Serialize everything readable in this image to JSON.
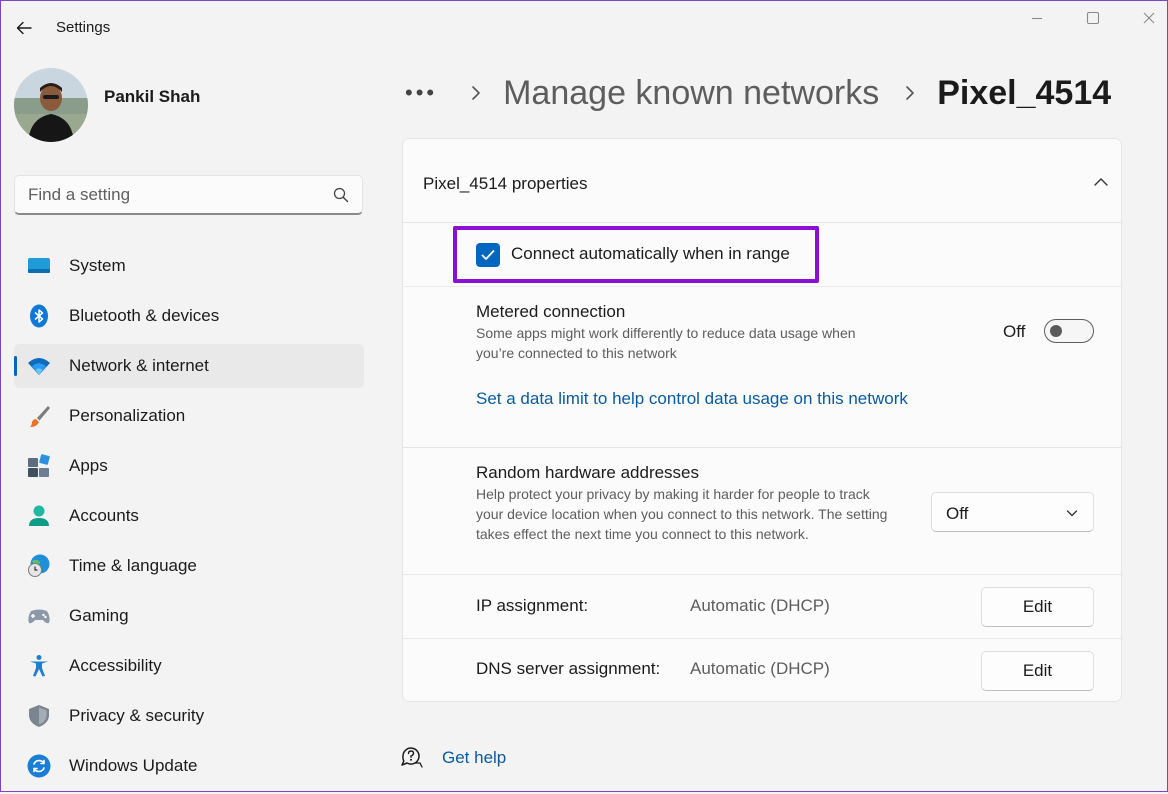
{
  "app": {
    "title": "Settings"
  },
  "user": {
    "name": "Pankil Shah"
  },
  "search": {
    "placeholder": "Find a setting"
  },
  "sidebar": {
    "items": [
      {
        "label": "System",
        "icon": "monitor-icon"
      },
      {
        "label": "Bluetooth & devices",
        "icon": "bluetooth-icon"
      },
      {
        "label": "Network & internet",
        "icon": "wifi-icon",
        "selected": true
      },
      {
        "label": "Personalization",
        "icon": "paintbrush-icon"
      },
      {
        "label": "Apps",
        "icon": "apps-icon"
      },
      {
        "label": "Accounts",
        "icon": "person-icon"
      },
      {
        "label": "Time & language",
        "icon": "globe-clock-icon"
      },
      {
        "label": "Gaming",
        "icon": "gamepad-icon"
      },
      {
        "label": "Accessibility",
        "icon": "accessibility-icon"
      },
      {
        "label": "Privacy & security",
        "icon": "shield-icon"
      },
      {
        "label": "Windows Update",
        "icon": "update-icon"
      }
    ]
  },
  "breadcrumb": {
    "overflow": "•••",
    "parent": "Manage known networks",
    "current": "Pixel_4514"
  },
  "properties": {
    "title": "Pixel_4514 properties",
    "connect_auto": {
      "label": "Connect automatically when in range",
      "checked": true
    },
    "metered": {
      "title": "Metered connection",
      "desc": "Some apps might work differently to reduce data usage when you’re connected to this network",
      "state": "Off",
      "link": "Set a data limit to help control data usage on this network"
    },
    "random_hw": {
      "title": "Random hardware addresses",
      "desc": "Help protect your privacy by making it harder for people to track your device location when you connect to this network. The setting takes effect the next time you connect to this network.",
      "value": "Off"
    },
    "ip": {
      "label": "IP assignment:",
      "value": "Automatic (DHCP)",
      "button": "Edit"
    },
    "dns": {
      "label": "DNS server assignment:",
      "value": "Automatic (DHCP)",
      "button": "Edit"
    }
  },
  "help": {
    "label": "Get help"
  },
  "colors": {
    "accent": "#0067c0",
    "highlight": "#8a10d6",
    "link": "#0a5aa0"
  }
}
